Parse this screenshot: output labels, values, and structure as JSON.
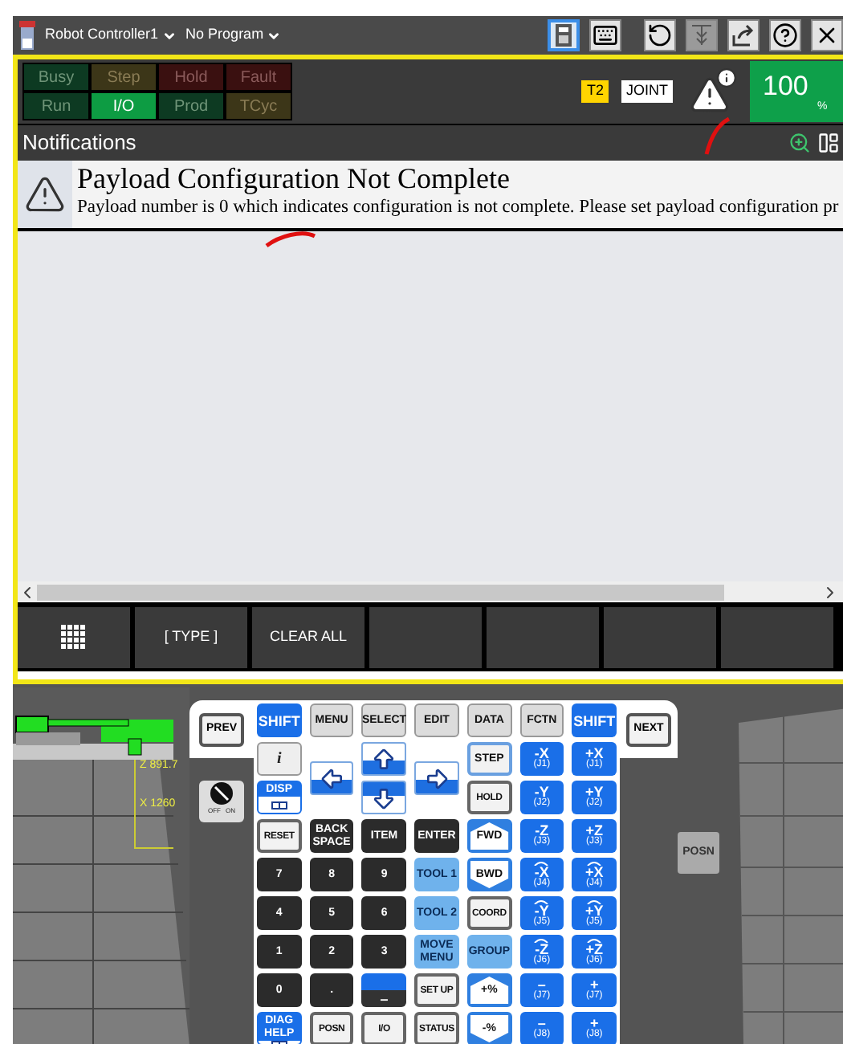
{
  "title_bar": {
    "controller": "Robot Controller1",
    "program": "No Program",
    "tools": [
      {
        "kind": "pendant",
        "selected": true,
        "disabled": false
      },
      {
        "kind": "keyboard",
        "selected": false,
        "disabled": false
      },
      {
        "kind": "refresh",
        "selected": false,
        "disabled": false
      },
      {
        "kind": "tool",
        "selected": false,
        "disabled": true
      },
      {
        "kind": "export",
        "selected": false,
        "disabled": false
      },
      {
        "kind": "help",
        "selected": false,
        "disabled": false
      },
      {
        "kind": "close",
        "selected": false,
        "disabled": false
      }
    ]
  },
  "status": {
    "lamps": [
      {
        "label": "Busy",
        "kind": "run",
        "on": false
      },
      {
        "label": "Step",
        "kind": "caution",
        "on": false
      },
      {
        "label": "Hold",
        "kind": "alarm",
        "on": false
      },
      {
        "label": "Fault",
        "kind": "alarm",
        "on": false
      },
      {
        "label": "Run",
        "kind": "run",
        "on": false
      },
      {
        "label": "I/O",
        "kind": "run",
        "on": true
      },
      {
        "label": "Prod",
        "kind": "run",
        "on": false
      },
      {
        "label": "TCyc",
        "kind": "caution",
        "on": false
      }
    ],
    "mode": "T2",
    "coord": "JOINT",
    "override": "100",
    "override_unit": "%"
  },
  "notifications": {
    "title": "Notifications",
    "items": [
      {
        "title": "Payload Configuration Not Complete",
        "message": "Payload number is 0 which indicates configuration is not complete. Please set payload configuration pr"
      }
    ]
  },
  "function_keys": [
    {
      "kind": "menu"
    },
    {
      "kind": "text",
      "label": "[ TYPE ]"
    },
    {
      "kind": "text",
      "label": "CLEAR ALL"
    },
    {
      "kind": "blank"
    },
    {
      "kind": "blank"
    },
    {
      "kind": "blank"
    },
    {
      "kind": "blank"
    }
  ],
  "view": {
    "z_label": "Z 891.7",
    "x_label": "X 1260"
  },
  "keypad": {
    "prev": "PREV",
    "next": "NEXT",
    "posn_side": "POSN",
    "switch_off": "OFF",
    "switch_on": "ON",
    "switch_state": {
      "on": false
    },
    "rows": [
      [
        {
          "kind": "blue",
          "label": "SHIFT"
        },
        {
          "kind": "gray",
          "label": "MENU"
        },
        {
          "kind": "gray",
          "label": "SELECT"
        },
        {
          "kind": "gray",
          "label": "EDIT"
        },
        {
          "kind": "gray",
          "label": "DATA"
        },
        {
          "kind": "gray",
          "label": "FCTN"
        },
        {
          "kind": "blue",
          "label": "SHIFT"
        }
      ],
      [
        {
          "kind": "info",
          "label": "i"
        },
        {
          "kind": "left"
        },
        {
          "kind": "up"
        },
        {
          "kind": "right"
        },
        {
          "kind": "light",
          "label": "STEP"
        },
        {
          "kind": "jog",
          "label": "-X",
          "sub": "(J1)"
        },
        {
          "kind": "jog",
          "label": "+X",
          "sub": "(J1)"
        }
      ],
      [
        {
          "kind": "disp",
          "label": "DISP"
        },
        "",
        {
          "kind": "down"
        },
        "",
        {
          "kind": "white",
          "label": "HOLD"
        },
        {
          "kind": "jog",
          "label": "-Y",
          "sub": "(J2)"
        },
        {
          "kind": "jog",
          "label": "+Y",
          "sub": "(J2)"
        }
      ],
      [
        {
          "kind": "white",
          "label": "RESET"
        },
        {
          "kind": "dark",
          "label": "BACK SPACE"
        },
        {
          "kind": "dark",
          "label": "ITEM"
        },
        {
          "kind": "dark",
          "label": "ENTER"
        },
        {
          "kind": "fwd",
          "label": "FWD"
        },
        {
          "kind": "jog",
          "label": "-Z",
          "sub": "(J3)"
        },
        {
          "kind": "jog",
          "label": "+Z",
          "sub": "(J3)"
        }
      ],
      [
        {
          "kind": "dark",
          "label": "7"
        },
        {
          "kind": "dark",
          "label": "8"
        },
        {
          "kind": "dark",
          "label": "9"
        },
        {
          "kind": "tool",
          "label": "TOOL 1"
        },
        {
          "kind": "bwd",
          "label": "BWD"
        },
        {
          "kind": "rot",
          "label": "-X",
          "sub": "(J4)"
        },
        {
          "kind": "rot",
          "label": "+X",
          "sub": "(J4)"
        }
      ],
      [
        {
          "kind": "dark",
          "label": "4"
        },
        {
          "kind": "dark",
          "label": "5"
        },
        {
          "kind": "dark",
          "label": "6"
        },
        {
          "kind": "tool",
          "label": "TOOL 2"
        },
        {
          "kind": "white",
          "label": "COORD"
        },
        {
          "kind": "rot",
          "label": "-Y",
          "sub": "(J5)"
        },
        {
          "kind": "rot",
          "label": "+Y",
          "sub": "(J5)"
        }
      ],
      [
        {
          "kind": "dark",
          "label": "1"
        },
        {
          "kind": "dark",
          "label": "2"
        },
        {
          "kind": "dark",
          "label": "3"
        },
        {
          "kind": "tool",
          "label": "MOVE MENU"
        },
        {
          "kind": "tool",
          "label": "GROUP"
        },
        {
          "kind": "rot",
          "label": "-Z",
          "sub": "(J6)"
        },
        {
          "kind": "rot",
          "label": "+Z",
          "sub": "(J6)"
        }
      ],
      [
        {
          "kind": "dark",
          "label": "0"
        },
        {
          "kind": "dark",
          "label": "."
        },
        {
          "kind": "split",
          "label": "–"
        },
        {
          "kind": "white",
          "label": "SET UP"
        },
        {
          "kind": "plus",
          "label": "+%"
        },
        {
          "kind": "jog",
          "label": "–",
          "sub": "(J7)"
        },
        {
          "kind": "jog",
          "label": "+",
          "sub": "(J7)"
        }
      ],
      [
        {
          "kind": "disp",
          "label": "DIAG HELP"
        },
        {
          "kind": "white",
          "label": "POSN"
        },
        {
          "kind": "white",
          "label": "I/O"
        },
        {
          "kind": "white",
          "label": "STATUS"
        },
        {
          "kind": "minus",
          "label": "-%"
        },
        {
          "kind": "jog",
          "label": "–",
          "sub": "(J8)"
        },
        {
          "kind": "jog",
          "label": "+",
          "sub": "(J8)"
        }
      ]
    ]
  }
}
